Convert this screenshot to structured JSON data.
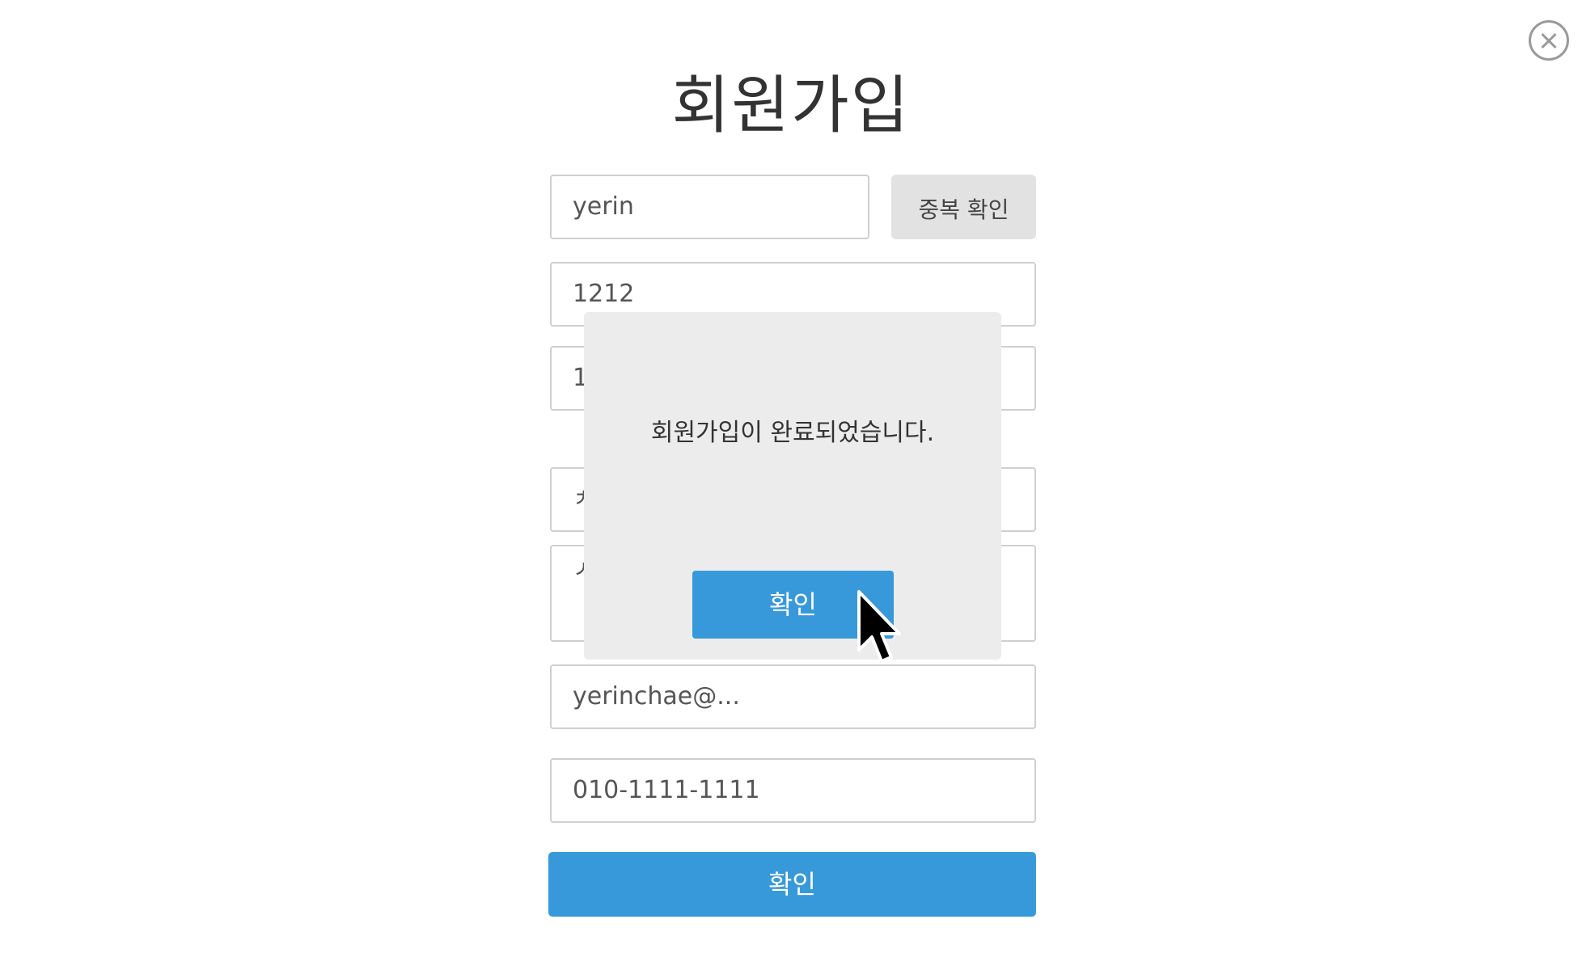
{
  "header": {
    "title": "회원가입",
    "close_icon": "close-circle-icon"
  },
  "form": {
    "username_value": "yerin",
    "duplicate_check_label": "중복 확인",
    "password_value": "1212",
    "password_confirm_value_partial": "1",
    "name_value_partial": "ㅊ",
    "address_value_partial": "ㅅ",
    "email_value": "yerinchae@...",
    "phone_value": "010-1111-1111",
    "submit_label": "확인"
  },
  "modal": {
    "message": "회원가입이 완료되었습니다.",
    "confirm_label": "확인"
  },
  "colors": {
    "primary": "#3899da",
    "modal_bg": "#ececec",
    "button_gray": "#e2e2e2",
    "border": "#cfcfcf"
  }
}
